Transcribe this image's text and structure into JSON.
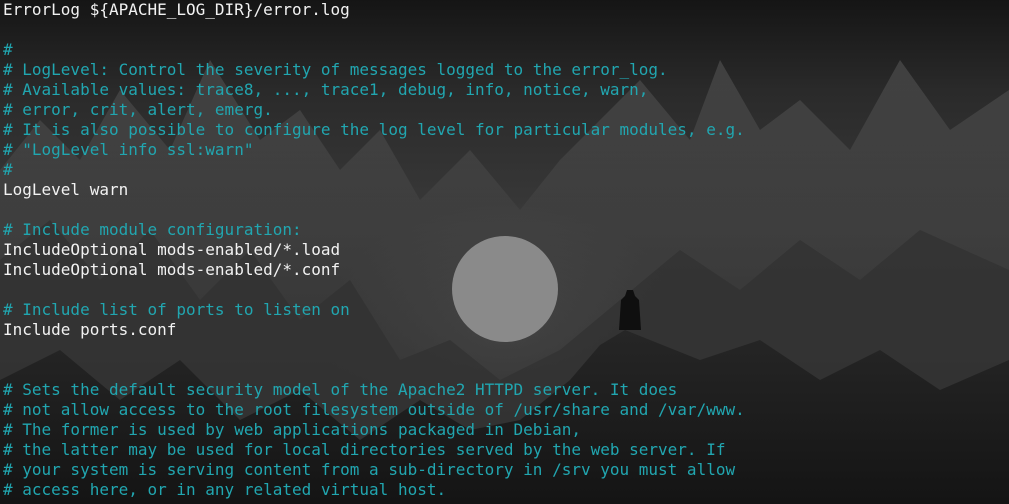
{
  "terminal": {
    "colors": {
      "code": "#f2f2f2",
      "comment": "#21a6b0"
    },
    "lines": [
      {
        "type": "code",
        "text": "ErrorLog ${APACHE_LOG_DIR}/error.log"
      },
      {
        "type": "blank",
        "text": ""
      },
      {
        "type": "comment",
        "text": "#"
      },
      {
        "type": "comment",
        "text": "# LogLevel: Control the severity of messages logged to the error_log."
      },
      {
        "type": "comment",
        "text": "# Available values: trace8, ..., trace1, debug, info, notice, warn,"
      },
      {
        "type": "comment",
        "text": "# error, crit, alert, emerg."
      },
      {
        "type": "comment",
        "text": "# It is also possible to configure the log level for particular modules, e.g."
      },
      {
        "type": "comment",
        "text": "# \"LogLevel info ssl:warn\""
      },
      {
        "type": "comment",
        "text": "#"
      },
      {
        "type": "code",
        "text": "LogLevel warn"
      },
      {
        "type": "blank",
        "text": ""
      },
      {
        "type": "comment",
        "text": "# Include module configuration:"
      },
      {
        "type": "code",
        "text": "IncludeOptional mods-enabled/*.load"
      },
      {
        "type": "code",
        "text": "IncludeOptional mods-enabled/*.conf"
      },
      {
        "type": "blank",
        "text": ""
      },
      {
        "type": "comment",
        "text": "# Include list of ports to listen on"
      },
      {
        "type": "code",
        "text": "Include ports.conf"
      },
      {
        "type": "blank",
        "text": ""
      },
      {
        "type": "blank",
        "text": ""
      },
      {
        "type": "comment",
        "text": "# Sets the default security model of the Apache2 HTTPD server. It does"
      },
      {
        "type": "comment",
        "text": "# not allow access to the root filesystem outside of /usr/share and /var/www."
      },
      {
        "type": "comment",
        "text": "# The former is used by web applications packaged in Debian,"
      },
      {
        "type": "comment",
        "text": "# the latter may be used for local directories served by the web server. If"
      },
      {
        "type": "comment",
        "text": "# your system is serving content from a sub-directory in /srv you must allow"
      },
      {
        "type": "comment",
        "text": "# access here, or in any related virtual host."
      }
    ]
  }
}
